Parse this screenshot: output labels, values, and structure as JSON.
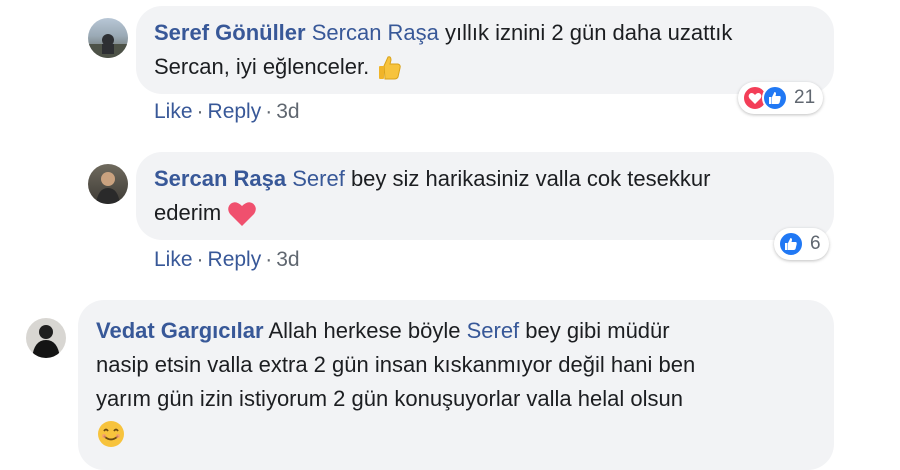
{
  "comments": [
    {
      "author": "Seref Gönüller",
      "mention": "Sercan Raşa",
      "text_line1": "yıllık iznini 2 gün daha uzattık",
      "text_line2": "Sercan, iyi eğlenceler.",
      "emoji": "thumbs-up",
      "like_label": "Like",
      "reply_label": "Reply",
      "time": "3d",
      "reactions": [
        "heart",
        "like"
      ],
      "reaction_count": "21"
    },
    {
      "author": "Sercan Raşa",
      "mention": "Seref",
      "text_line1": "bey siz harikasiniz valla cok tesekkur",
      "text_line2": "ederim",
      "emoji": "heart",
      "like_label": "Like",
      "reply_label": "Reply",
      "time": "3d",
      "reactions": [
        "like"
      ],
      "reaction_count": "6"
    },
    {
      "author": "Vedat Gargıcılar",
      "text_line1_pre": "Allah herkese böyle",
      "mention": "Seref",
      "text_line1_post": "bey gibi müdür",
      "text_line2": "nasip etsin valla extra 2 gün insan kıskanmıyor değil hani ben",
      "text_line3": "yarım gün izin istiyorum 2 gün konuşuyorlar valla helal olsun",
      "emoji": "smiling-face"
    }
  ],
  "colors": {
    "link": "#385898",
    "bubble": "#f2f3f5",
    "like_blue": "#2078f4",
    "heart_red": "#f33e58"
  }
}
